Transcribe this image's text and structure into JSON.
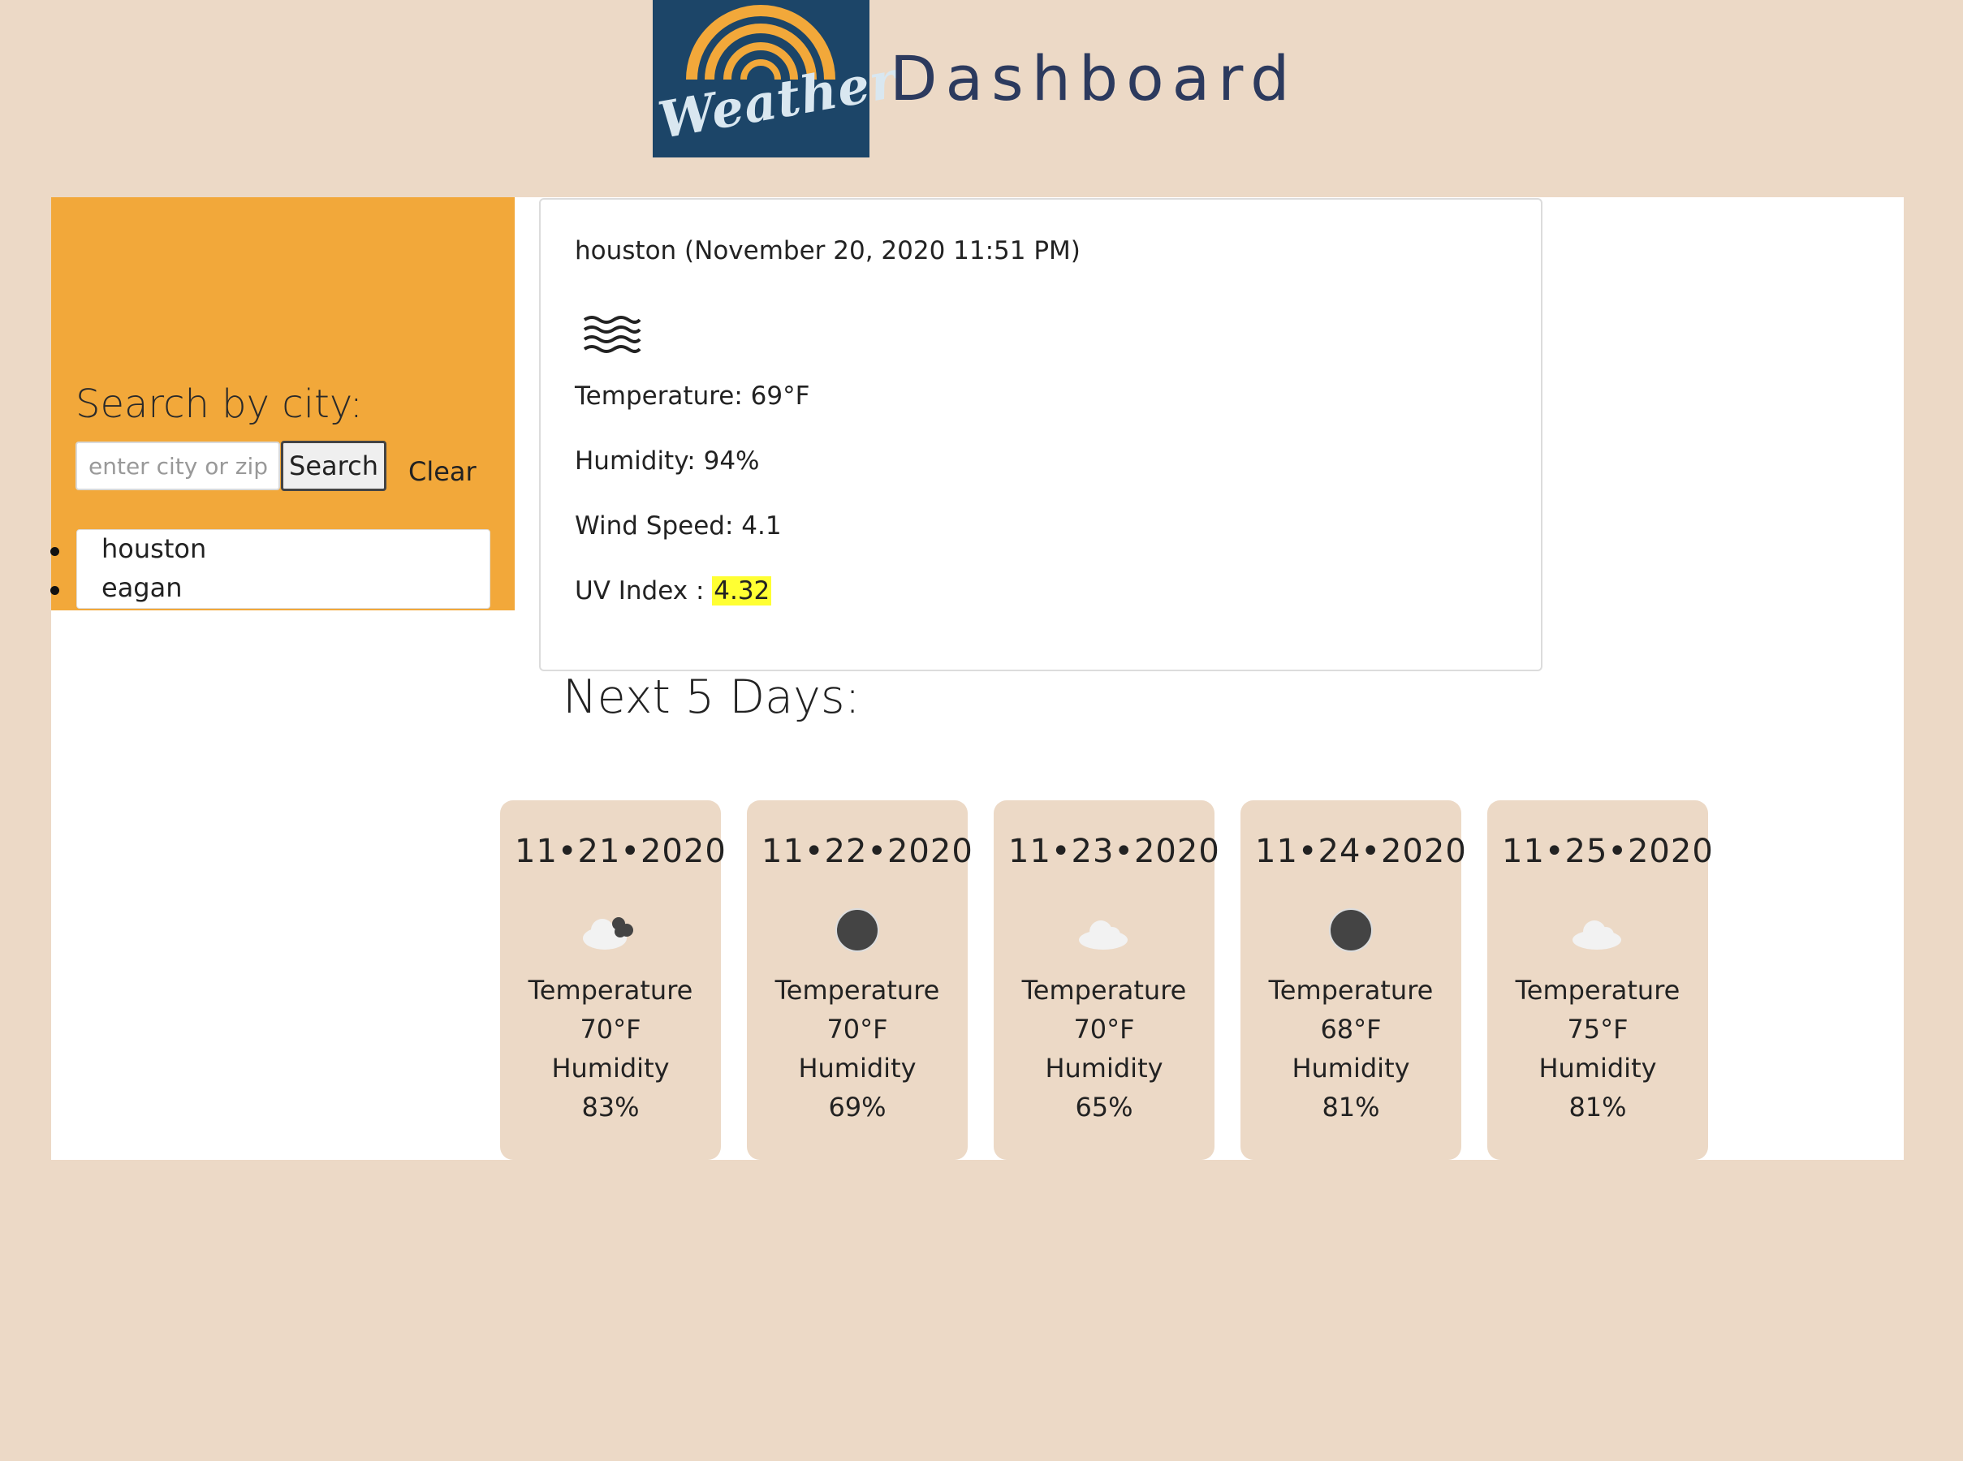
{
  "header": {
    "logo_text": "Weather",
    "title": "Dashboard",
    "logo_icon": "rainbow-logo-icon"
  },
  "colors": {
    "background": "#ecd9c6",
    "sidebar": "#f2a83a",
    "logo_bg": "#1c4568",
    "uv_highlight": "#ffff33"
  },
  "sidebar": {
    "heading": "Search by city:",
    "search_placeholder": "enter city or zip code",
    "search_button": "Search",
    "clear_button": "Clear",
    "history": [
      "houston",
      "eagan"
    ]
  },
  "current": {
    "title": "houston (November 20, 2020 11:51 PM)",
    "icon": "mist-icon",
    "temperature": "Temperature: 69°F",
    "humidity": "Humidity: 94%",
    "wind": "Wind Speed: 4.1",
    "uv_label": "UV Index : ",
    "uv_value": "4.32"
  },
  "forecast": {
    "heading": "Next 5 Days:",
    "days": [
      {
        "date": "11•21•2020",
        "icon": "partly-cloudy-icon",
        "temp_label": "Temperature",
        "temp": "70°F",
        "hum_label": "Humidity",
        "hum": "83%"
      },
      {
        "date": "11•22•2020",
        "icon": "clear-night-icon",
        "temp_label": "Temperature",
        "temp": "70°F",
        "hum_label": "Humidity",
        "hum": "69%"
      },
      {
        "date": "11•23•2020",
        "icon": "cloud-icon",
        "temp_label": "Temperature",
        "temp": "70°F",
        "hum_label": "Humidity",
        "hum": "65%"
      },
      {
        "date": "11•24•2020",
        "icon": "clear-night-icon",
        "temp_label": "Temperature",
        "temp": "68°F",
        "hum_label": "Humidity",
        "hum": "81%"
      },
      {
        "date": "11•25•2020",
        "icon": "cloud-icon",
        "temp_label": "Temperature",
        "temp": "75°F",
        "hum_label": "Humidity",
        "hum": "81%"
      }
    ]
  }
}
